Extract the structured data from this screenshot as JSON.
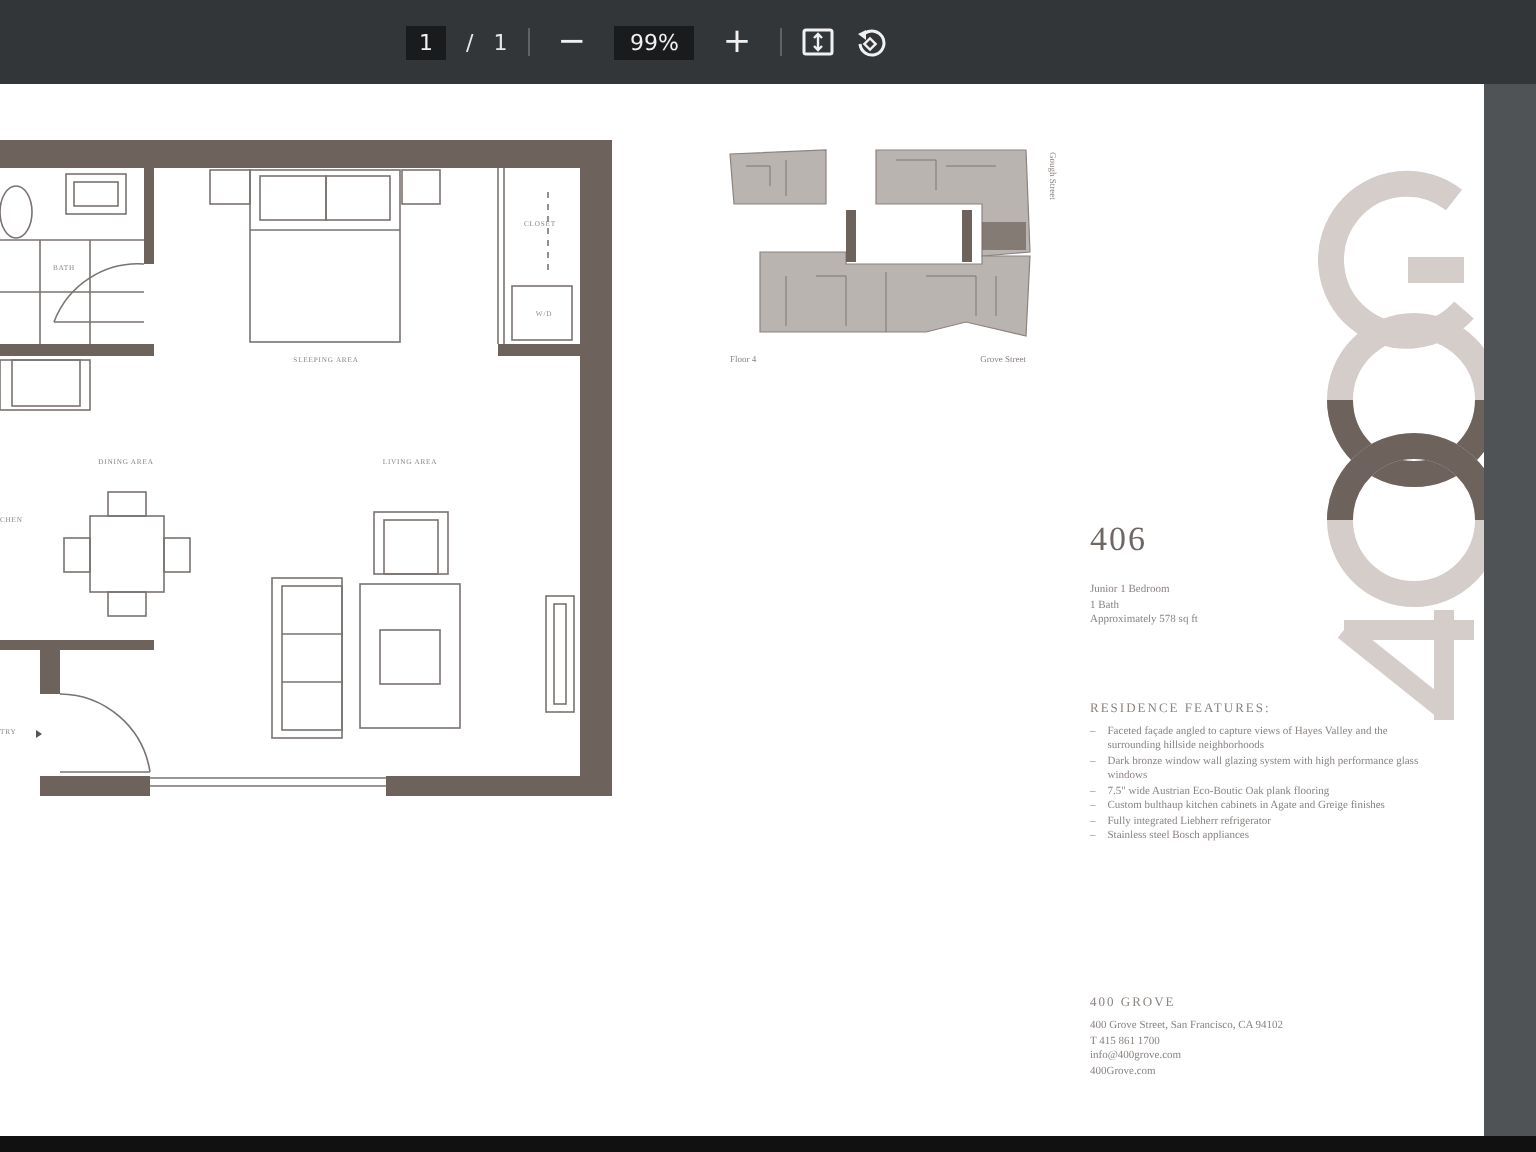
{
  "toolbar": {
    "page_value": "1",
    "page_separator": "/",
    "page_count": "1",
    "zoom_out": "−",
    "zoom": "99%",
    "zoom_in": "+"
  },
  "floor_plan": {
    "labels": [
      {
        "text": "BATH"
      },
      {
        "text": "CLOSET"
      },
      {
        "text": "W/D"
      },
      {
        "text": "SLEEPING AREA"
      },
      {
        "text": "DINING AREA"
      },
      {
        "text": "LIVING AREA"
      },
      {
        "text": "CHEN"
      },
      {
        "text": "TRY"
      }
    ]
  },
  "key_plan": {
    "floor": "Floor 4",
    "bottom_street": "Grove Street",
    "side_street": "Gough Street"
  },
  "unit": {
    "number": "406",
    "details": [
      "Junior 1 Bedroom",
      "1 Bath",
      "Approximately 578 sq ft"
    ]
  },
  "features": {
    "heading": "RESIDENCE FEATURES:",
    "items": [
      {
        "bullet": "–",
        "text": "Faceted façade angled to capture views of Hayes Valley and the surrounding hillside neighborhoods"
      },
      {
        "bullet": "–",
        "text": "Dark bronze window wall glazing system with high performance glass windows"
      },
      {
        "bullet": "–",
        "text": "7.5\" wide Austrian Eco-Boutic Oak plank flooring"
      },
      {
        "bullet": "–",
        "text": "Custom bulthaup kitchen cabinets in Agate and Greige finishes"
      },
      {
        "bullet": "–",
        "text": "Fully integrated Liebherr refrigerator"
      },
      {
        "bullet": "–",
        "text": "Stainless steel Bosch appliances"
      }
    ]
  },
  "contact": {
    "name": "400 GROVE",
    "lines": [
      "400 Grove Street, San Francisco, CA 94102",
      "T 415 861 1700",
      "info@400grove.com",
      "400Grove.com"
    ]
  }
}
